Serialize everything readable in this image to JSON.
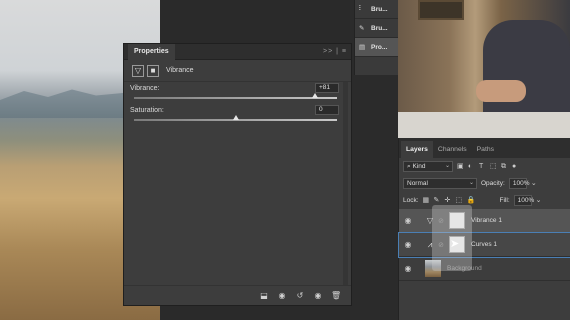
{
  "properties": {
    "tab_label": "Properties",
    "menu": ">> | ≡",
    "adjustment_title": "Vibrance",
    "vibrance": {
      "label": "Vibrance:",
      "value": "+81",
      "slider_fraction": 0.89
    },
    "saturation": {
      "label": "Saturation:",
      "value": "0",
      "slider_fraction": 0.5
    }
  },
  "collapsed_panels": [
    {
      "label": "Bru...",
      "icon": "brush-settings-icon"
    },
    {
      "label": "Bru...",
      "icon": "brush-icon"
    },
    {
      "label": "Pro...",
      "icon": "properties-icon"
    }
  ],
  "layers_panel": {
    "tabs": [
      "Layers",
      "Channels",
      "Paths"
    ],
    "filter_kind": "Kind",
    "blend_mode": "Normal",
    "opacity_label": "Opacity:",
    "opacity_value": "100%",
    "lock_label": "Lock:",
    "fill_label": "Fill:",
    "fill_value": "100%",
    "layers": [
      {
        "name": "Vibrance 1",
        "type": "vibrance",
        "selected": true
      },
      {
        "name": "Curves 1",
        "type": "curves",
        "selected": false
      },
      {
        "name": "Background",
        "type": "image",
        "selected": false
      }
    ]
  },
  "colors": {
    "panel": "#3d3d3d",
    "dark": "#2b2b2b",
    "accent": "#4a7fb5"
  }
}
